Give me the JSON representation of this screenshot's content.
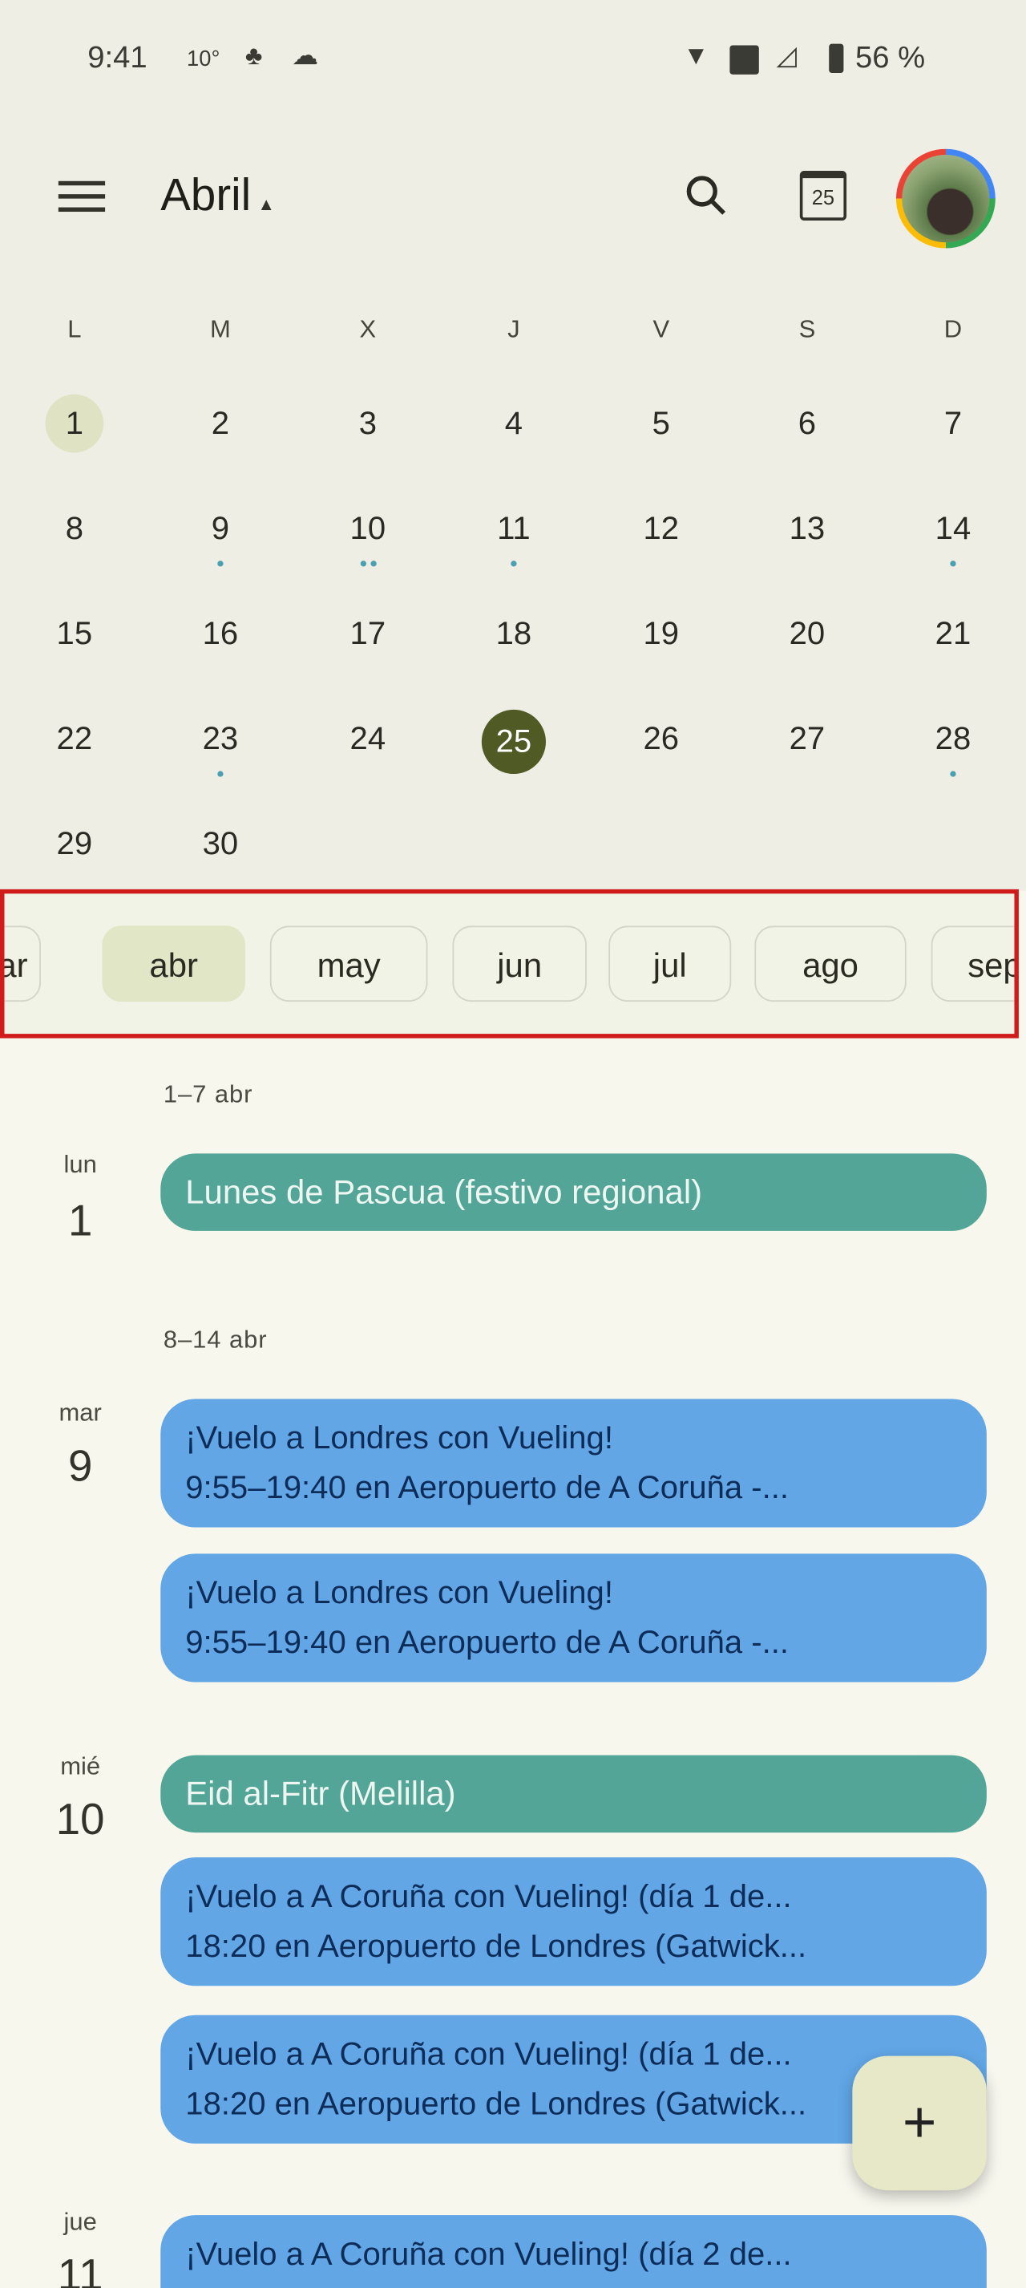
{
  "status_bar": {
    "time": "9:41",
    "temp": "10°",
    "battery": "56 %"
  },
  "header": {
    "title": "Abril",
    "today_icon_day": "25"
  },
  "calendar": {
    "weekdays": [
      "L",
      "M",
      "X",
      "J",
      "V",
      "S",
      "D"
    ],
    "weeks": [
      [
        "1",
        "2",
        "3",
        "4",
        "5",
        "6",
        "7"
      ],
      [
        "8",
        "9",
        "10",
        "11",
        "12",
        "13",
        "14"
      ],
      [
        "15",
        "16",
        "17",
        "18",
        "19",
        "20",
        "21"
      ],
      [
        "22",
        "23",
        "24",
        "25",
        "26",
        "27",
        "28"
      ],
      [
        "29",
        "30",
        "",
        "",
        "",
        "",
        ""
      ]
    ],
    "selected": "1",
    "today": "25",
    "event_dots": {
      "9": 1,
      "10": 2,
      "11": 1,
      "14": 1,
      "23": 1,
      "28": 1
    }
  },
  "months": [
    "mar",
    "abr",
    "may",
    "jun",
    "jul",
    "ago",
    "sep"
  ],
  "selected_month": "abr",
  "agenda": {
    "ranges": [
      "1–7 abr",
      "8–14 abr"
    ],
    "days": [
      {
        "wd": "lun",
        "d": "1"
      },
      {
        "wd": "mar",
        "d": "9"
      },
      {
        "wd": "mié",
        "d": "10"
      },
      {
        "wd": "jue",
        "d": "11"
      }
    ],
    "events": [
      {
        "title": "Lunes de Pascua (festivo regional)",
        "color": "#52a597"
      },
      {
        "title": "¡Vuelo a Londres  con Vueling!",
        "sub": "9:55–19:40 en Aeropuerto de A Coruña -...",
        "color": "#62a6e6"
      },
      {
        "title": "¡Vuelo a Londres  con Vueling!",
        "sub": "9:55–19:40 en Aeropuerto de A Coruña -...",
        "color": "#62a6e6"
      },
      {
        "title": "Eid al-Fitr (Melilla)",
        "color": "#52a597"
      },
      {
        "title": "¡Vuelo a A Coruña con Vueling! (día 1 de...",
        "sub": "18:20 en Aeropuerto de Londres (Gatwick...",
        "color": "#62a6e6"
      },
      {
        "title": "¡Vuelo a A Coruña con Vueling! (día 1 de...",
        "sub": "18:20 en Aeropuerto de Londres (Gatwick...",
        "color": "#62a6e6"
      },
      {
        "title": "¡Vuelo a A Coruña con Vueling! (día 2 de...",
        "color": "#62a6e6"
      }
    ]
  },
  "fab": {
    "label": "+"
  }
}
